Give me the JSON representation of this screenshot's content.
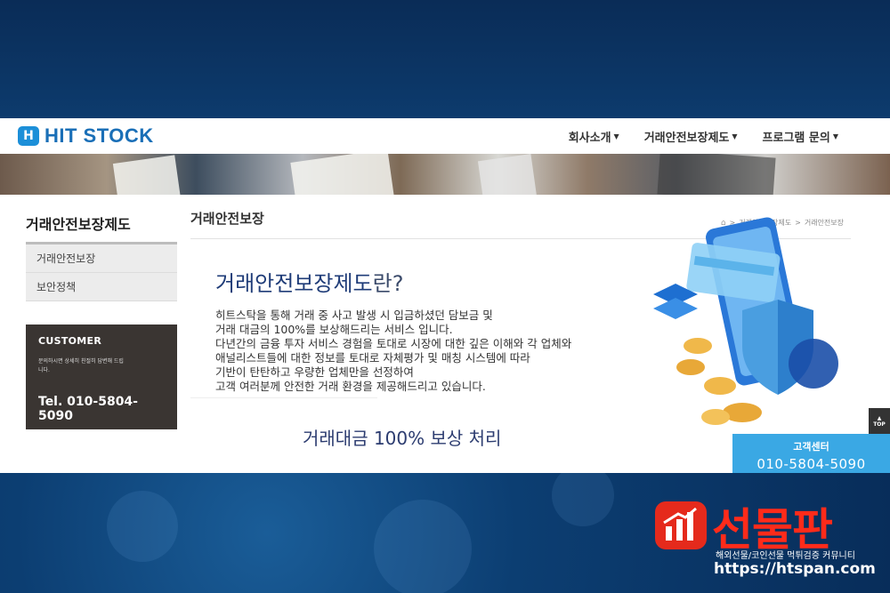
{
  "header": {
    "logo_mark": "H",
    "logo_text": "HIT STOCK",
    "nav": [
      {
        "label": "회사소개"
      },
      {
        "label": "거래안전보장제도"
      },
      {
        "label": "프로그램 문의"
      }
    ]
  },
  "sidebar": {
    "title": "거래안전보장제도",
    "items": [
      {
        "label": "거래안전보장"
      },
      {
        "label": "보안정책"
      }
    ]
  },
  "customer": {
    "title": "CUSTOMER",
    "desc": "문의하시면 상세히 친절히 답변해 드립니다.",
    "tel": "Tel. 010-5804-5090"
  },
  "main": {
    "title": "거래안전보장",
    "breadcrumb": [
      "거래안전보장제도",
      "거래안전보장"
    ],
    "intro_title": "거래안전보장제도",
    "intro_suffix": "란?",
    "intro_lines": [
      "히트스탁을 통해 거래 중 사고 발생 시 입금하셨던 담보금 및",
      "거래 대금의 100%를 보상해드리는 서비스 입니다.",
      "다년간의 금융 투자 서비스 경험을 토대로 시장에 대한 깊은 이해와 각 업체와",
      "애널리스트들에 대한 정보를 토대로 자체평가 및 매칭 시스템에 따라",
      "기반이 탄탄하고 우량한 업체만을 선정하여",
      "고객 여러분께 안전한 거래 환경을 제공해드리고 있습니다."
    ],
    "sub_heading": "거래대금 100% 보상 처리"
  },
  "floating": {
    "top_label": "TOP",
    "cs_label": "고객센터",
    "cs_number": "010-5804-5090"
  },
  "brand": {
    "name": "선물판",
    "tagline": "해외선물/코인선물 먹튀검증 커뮤니티",
    "url": "https://htspan.com"
  },
  "colors": {
    "accent": "#1a6fb7",
    "cs_box": "#3aa8e4",
    "brand_red": "#ff2b1a",
    "background": "#0c3a6a"
  }
}
